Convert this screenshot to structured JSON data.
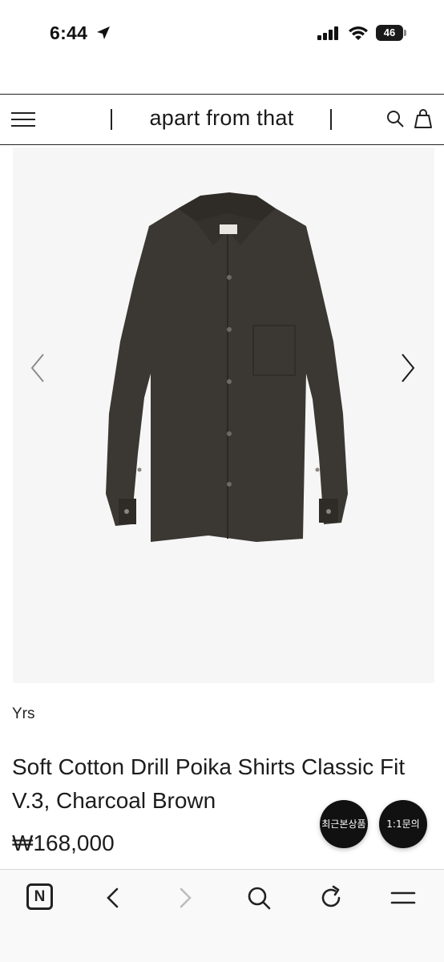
{
  "status_bar": {
    "time": "6:44",
    "battery": "46"
  },
  "header": {
    "brand": "apart from that"
  },
  "product": {
    "brand": "Yrs",
    "title": "Soft Cotton Drill Poika Shirts Classic Fit V.3, Charcoal Brown",
    "price": "₩168,000",
    "image_label": "YRS"
  },
  "floating_buttons": {
    "recent": "최근본상품",
    "inquiry": "1:1문의"
  },
  "colors": {
    "shirt": "#3b3833",
    "image_bg": "#f6f6f6",
    "fab_bg": "#111111"
  },
  "icons": [
    "location-arrow-icon",
    "signal-icon",
    "wifi-icon",
    "battery-icon",
    "menu-icon",
    "search-icon",
    "shopping-bag-icon",
    "chevron-left-icon",
    "chevron-right-icon",
    "naver-icon",
    "back-icon",
    "forward-icon",
    "search-icon",
    "refresh-icon",
    "tabs-menu-icon"
  ]
}
